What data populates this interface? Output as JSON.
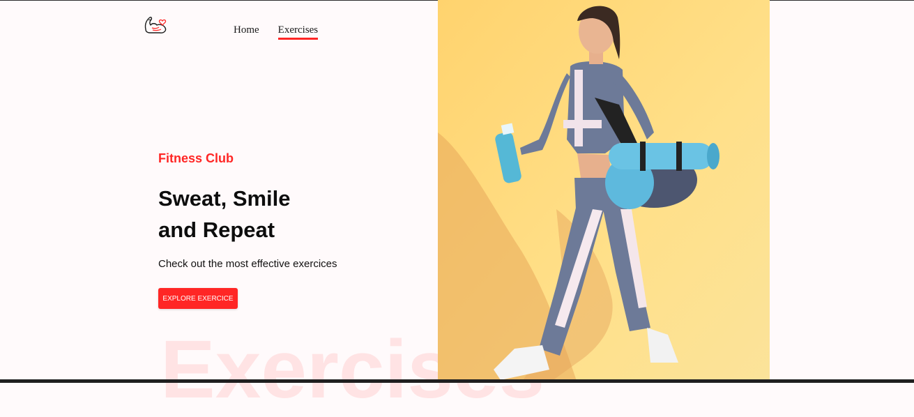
{
  "header": {
    "logo_icon": "flexed-arm-heart-icon",
    "nav": [
      {
        "label": "Home",
        "active": false
      },
      {
        "label": "Exercises",
        "active": true
      }
    ]
  },
  "hero": {
    "subtitle": "Fitness Club",
    "headline_line1": "Sweat, Smile",
    "headline_line2": "and Repeat",
    "description": "Check out the most effective exercices",
    "cta_label": "EXPLORE EXERCICE",
    "watermark": "Exercises",
    "image_alt": "woman-walking-with-yoga-mat-and-bottle"
  },
  "colors": {
    "accent": "#ff2625",
    "background": "#fffafb",
    "image_background": "#ffd977"
  }
}
